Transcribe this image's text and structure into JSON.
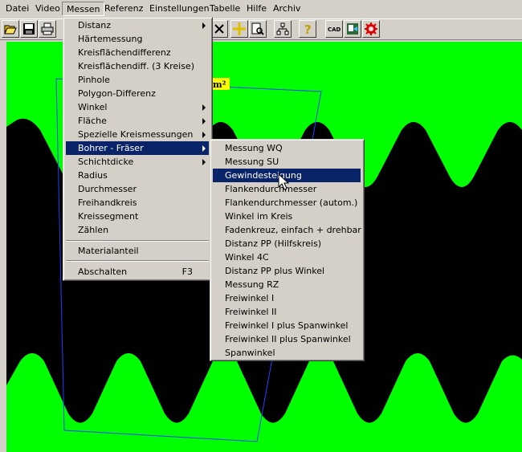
{
  "menubar": {
    "items": [
      "Datei",
      "Video",
      "Messen",
      "Referenz",
      "Einstellungen",
      "Tabelle",
      "Hilfe",
      "Archiv"
    ],
    "active": "Messen"
  },
  "toolbar": {
    "buttons": [
      "open-icon",
      "save-icon",
      "print-icon",
      "crosshair-icon",
      "measure-line-icon",
      "zoom-icon",
      "tree-icon",
      "help-icon",
      "cad-icon",
      "export-icon",
      "settings-gear-icon"
    ],
    "cad_label": "CAD"
  },
  "overlay": {
    "area_label": "m²"
  },
  "colors": {
    "background_green": "#00ff00",
    "menu_highlight": "#0a246a",
    "label_yellow": "#ffff00"
  },
  "messen_menu": {
    "items": [
      {
        "label": "Distanz",
        "submenu": true
      },
      {
        "label": "Härtemessung",
        "submenu": false
      },
      {
        "label": "Kreisflächendifferenz",
        "submenu": false
      },
      {
        "label": "Kreisflächendiff. (3 Kreise)",
        "submenu": false
      },
      {
        "label": "Pinhole",
        "submenu": false
      },
      {
        "label": "Polygon-Differenz",
        "submenu": false
      },
      {
        "label": "Winkel",
        "submenu": true
      },
      {
        "label": "Fläche",
        "submenu": true
      },
      {
        "label": "Spezielle Kreismessungen",
        "submenu": true
      },
      {
        "label": "Bohrer - Fräser",
        "submenu": true,
        "highlighted": true
      },
      {
        "label": "Schichtdicke",
        "submenu": true
      },
      {
        "label": "Radius",
        "submenu": false
      },
      {
        "label": "Durchmesser",
        "submenu": false
      },
      {
        "label": "Freihandkreis",
        "submenu": false
      },
      {
        "label": "Kreissegment",
        "submenu": false
      },
      {
        "label": "Zählen",
        "submenu": false
      }
    ],
    "material": "Materialanteil",
    "abschalten": "Abschalten",
    "abschalten_shortcut": "F3"
  },
  "bohrer_submenu": {
    "items": [
      "Messung WQ",
      "Messung SU",
      "Gewindesteigung",
      "Flankendurchmesser",
      "Flankendurchmesser (autom.)",
      "Winkel im Kreis",
      "Fadenkreuz, einfach + drehbar",
      "Distanz PP (Hilfskreis)",
      "Winkel 4C",
      "Distanz PP plus Winkel",
      "Messung RZ",
      "Freiwinkel I",
      "Freiwinkel II",
      "Freiwinkel I plus Spanwinkel",
      "Freiwinkel II plus Spanwinkel",
      "Spanwinkel"
    ],
    "highlighted": "Gewindesteigung"
  }
}
